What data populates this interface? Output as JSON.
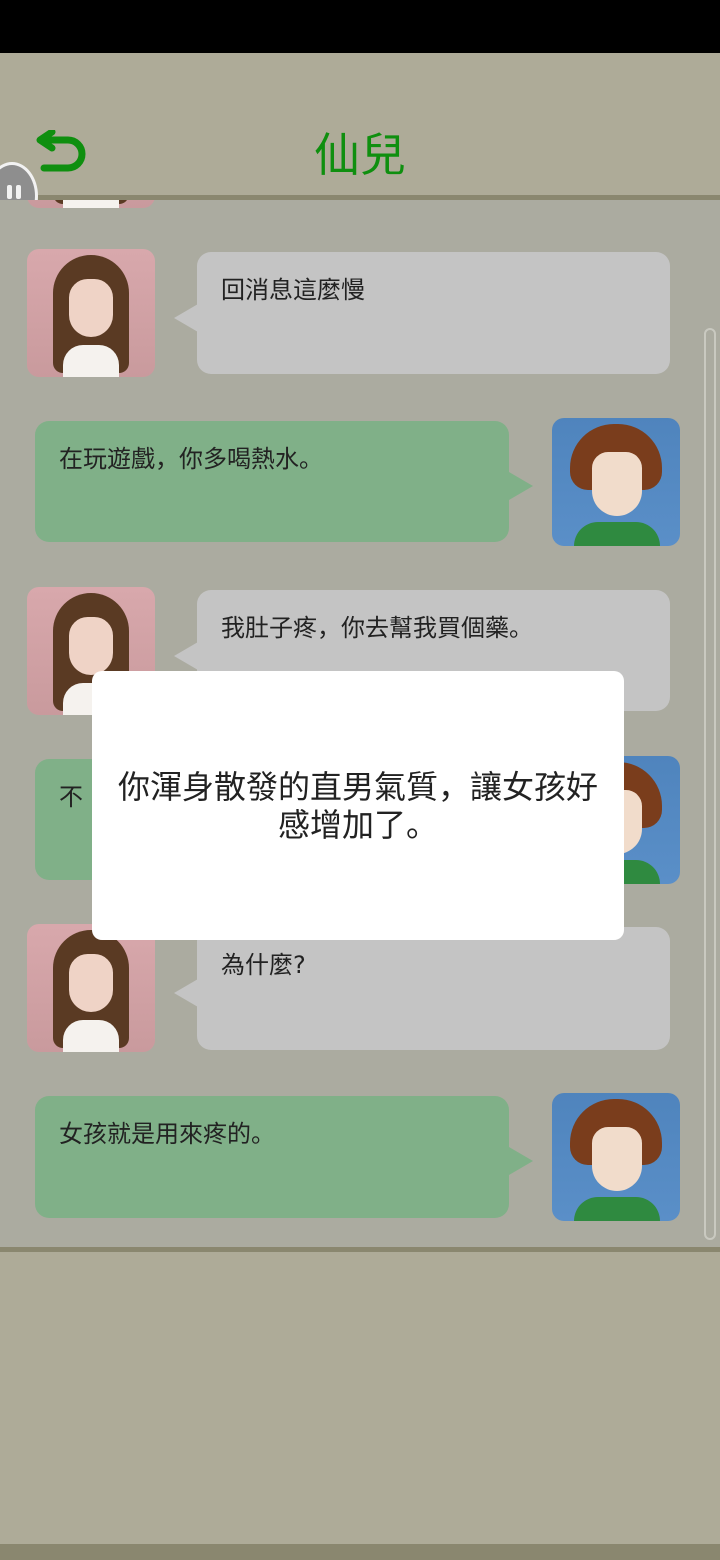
{
  "header": {
    "title": "仙兒",
    "back_icon": "back-arrow-icon",
    "accent_color": "#0f8f0f"
  },
  "floating_button": {
    "icon": "pause-icon"
  },
  "messages": [
    {
      "sender": "girl",
      "text": "回消息這麼慢"
    },
    {
      "sender": "boy",
      "text": "在玩遊戲，你多喝熱水。"
    },
    {
      "sender": "girl",
      "text": "我肚子疼，你去幫我買個藥。"
    },
    {
      "sender": "boy",
      "text": "不"
    },
    {
      "sender": "girl",
      "text": "為什麼?"
    },
    {
      "sender": "boy",
      "text": "女孩就是用來疼的。"
    }
  ],
  "modal": {
    "text": "你渾身散發的直男氣質，讓女孩好感增加了。"
  }
}
